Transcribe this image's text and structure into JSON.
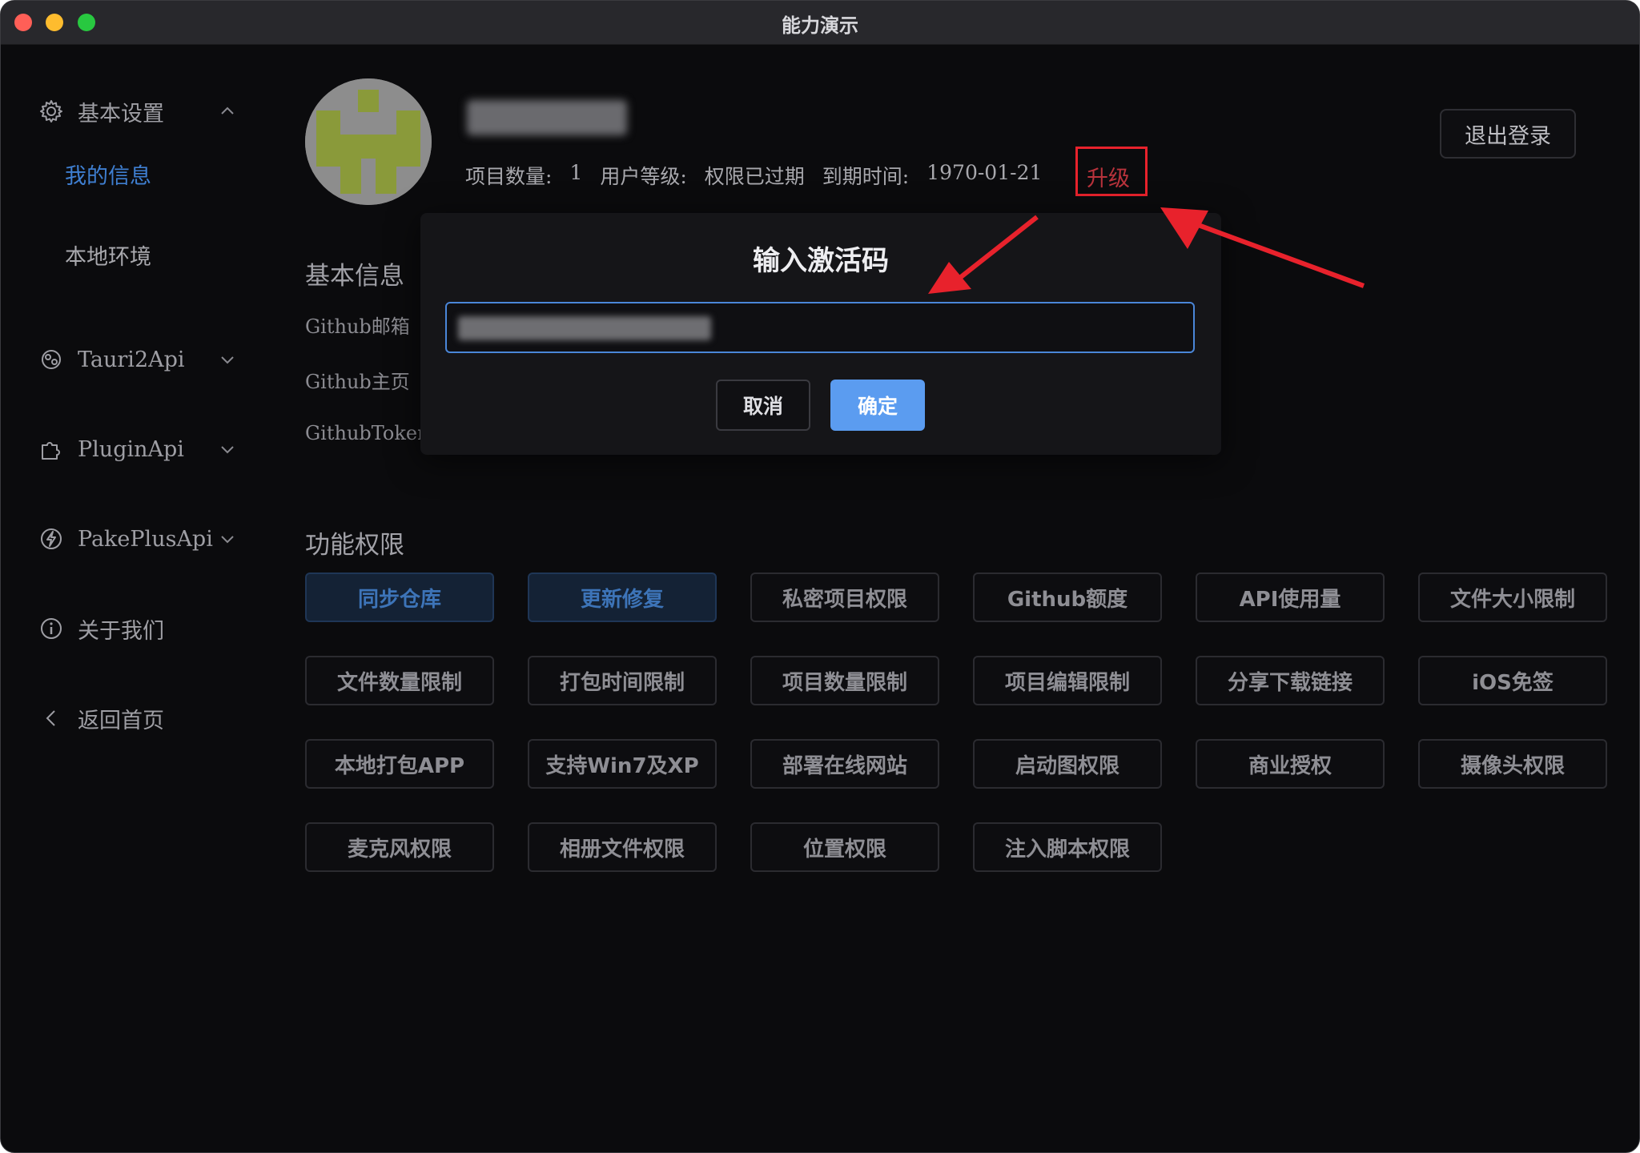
{
  "window": {
    "title": "能力演示"
  },
  "sidebar": {
    "basic_settings": {
      "label": "基本设置",
      "icon": "gear-icon",
      "expanded": true,
      "children": [
        {
          "label": "我的信息",
          "active": true
        },
        {
          "label": "本地环境",
          "active": false
        }
      ]
    },
    "tauri2api": {
      "label": "Tauri2Api",
      "icon": "tauri-icon"
    },
    "pluginapi": {
      "label": "PluginApi",
      "icon": "puzzle-icon"
    },
    "pakeplusapi": {
      "label": "PakePlusApi",
      "icon": "lightning-icon"
    },
    "about": {
      "label": "关于我们",
      "icon": "info-icon"
    },
    "back_home": {
      "label": "返回首页",
      "icon": "chevron-left-icon"
    }
  },
  "profile": {
    "project_count_label": "项目数量:",
    "project_count": "1",
    "user_level_label": "用户等级:",
    "user_level": "权限已过期",
    "expire_label": "到期时间:",
    "expire_date": "1970-01-21",
    "upgrade": "升级",
    "logout": "退出登录"
  },
  "basic_info": {
    "title": "基本信息",
    "fields": [
      "Github邮箱",
      "Github主页",
      "GithubToken"
    ]
  },
  "permissions": {
    "title": "功能权限",
    "items": [
      {
        "label": "同步仓库",
        "active": true
      },
      {
        "label": "更新修复",
        "active": true
      },
      {
        "label": "私密项目权限"
      },
      {
        "label": "Github额度"
      },
      {
        "label": "API使用量"
      },
      {
        "label": "文件大小限制"
      },
      {
        "label": "文件数量限制"
      },
      {
        "label": "打包时间限制"
      },
      {
        "label": "项目数量限制"
      },
      {
        "label": "项目编辑限制"
      },
      {
        "label": "分享下载链接"
      },
      {
        "label": "iOS免签"
      },
      {
        "label": "本地打包APP"
      },
      {
        "label": "支持Win7及XP"
      },
      {
        "label": "部署在线网站"
      },
      {
        "label": "启动图权限"
      },
      {
        "label": "商业授权"
      },
      {
        "label": "摄像头权限"
      },
      {
        "label": "麦克风权限"
      },
      {
        "label": "相册文件权限"
      },
      {
        "label": "位置权限"
      },
      {
        "label": "注入脚本权限"
      }
    ]
  },
  "dialog": {
    "title": "输入激活码",
    "cancel": "取消",
    "confirm": "确定"
  },
  "colors": {
    "accent": "#5b9cf0",
    "annotation_red": "#e8222c",
    "background": "#0b0b0d"
  }
}
